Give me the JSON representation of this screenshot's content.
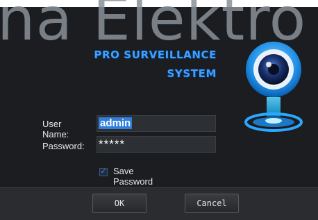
{
  "watermark": "na Elektro",
  "brand": {
    "line1": "PRO SURVEILLANCE",
    "line2": "SYSTEM"
  },
  "form": {
    "username_label": "User Name:",
    "username_value": "admin",
    "password_label": "Password:",
    "password_value": "*****",
    "save_password_label": "Save Password",
    "save_password_checked": true
  },
  "buttons": {
    "ok": "OK",
    "cancel": "Cancel"
  },
  "colors": {
    "accent": "#3fa0ff",
    "background": "#1b1d20",
    "footer": "#2a2c30"
  },
  "icons": {
    "camera": "webcam-icon",
    "checkbox": "checkmark-icon"
  }
}
